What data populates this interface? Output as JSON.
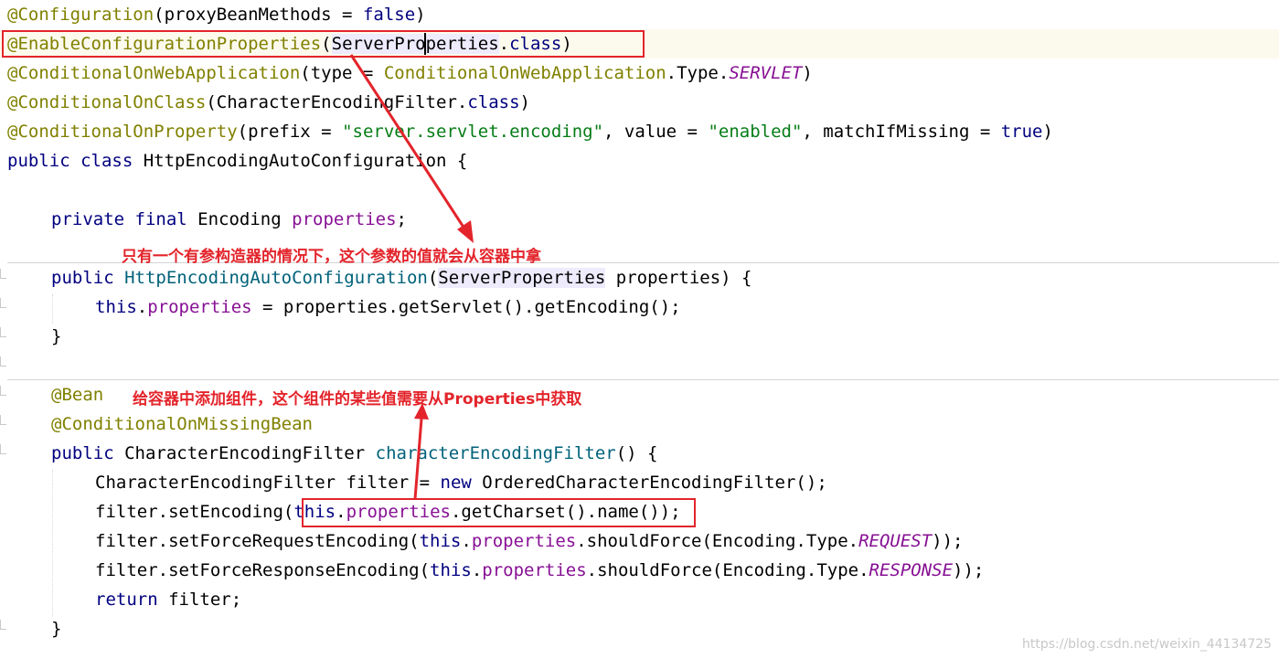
{
  "code": {
    "l1": {
      "a": "@Configuration",
      "b": "(proxyBeanMethods = ",
      "c": "false",
      "d": ")"
    },
    "l2": {
      "a": "@EnableConfigurationProperties",
      "b": "(",
      "c": "ServerProperties",
      "d": ".",
      "e": "class",
      "f": ")"
    },
    "l3": {
      "a": "@ConditionalOnWebApplication",
      "b": "(type = ",
      "c": "ConditionalOnWebApplication",
      "d": ".Type.",
      "e": "SERVLET",
      "f": ")"
    },
    "l4": {
      "a": "@ConditionalOnClass",
      "b": "(CharacterEncodingFilter.",
      "c": "class",
      "d": ")"
    },
    "l5": {
      "a": "@ConditionalOnProperty",
      "b": "(prefix = ",
      "c": "\"server.servlet.encoding\"",
      "d": ", value = ",
      "e": "\"enabled\"",
      "f": ", matchIfMissing = ",
      "g": "true",
      "h": ")"
    },
    "l6": {
      "a": "public",
      "b": " ",
      "c": "class",
      "d": " HttpEncodingAutoConfiguration {"
    },
    "l7": {
      "a": "private",
      "b": " ",
      "c": "final",
      "d": " Encoding ",
      "e": "properties",
      "f": ";"
    },
    "l8": {
      "a": "public",
      "b": " ",
      "c": "HttpEncodingAutoConfiguration",
      "d": "(",
      "e": "ServerProperties",
      "f": " properties) {"
    },
    "l9": {
      "a": "this",
      "b": ".",
      "c": "properties",
      "d": " = properties.getServlet().getEncoding();"
    },
    "l10": {
      "a": "}"
    },
    "l11": {
      "a": "@Bean"
    },
    "l12": {
      "a": "@ConditionalOnMissingBean"
    },
    "l13": {
      "a": "public",
      "b": " CharacterEncodingFilter ",
      "c": "characterEncodingFilter",
      "d": "() {"
    },
    "l14": {
      "a": "CharacterEncodingFilter filter = ",
      "b": "new",
      "c": " OrderedCharacterEncodingFilter();"
    },
    "l15": {
      "a": "filter.setEncoding(",
      "b": "this",
      "c": ".",
      "d": "properties",
      "e": ".getCharset().name());"
    },
    "l16": {
      "a": "filter.setForceRequestEncoding(",
      "b": "this",
      "c": ".",
      "d": "properties",
      "e": ".shouldForce(Encoding.Type.",
      "f": "REQUEST",
      "g": "));"
    },
    "l17": {
      "a": "filter.setForceResponseEncoding(",
      "b": "this",
      "c": ".",
      "d": "properties",
      "e": ".shouldForce(Encoding.Type.",
      "f": "RESPONSE",
      "g": "));"
    },
    "l18": {
      "a": "return",
      "b": " filter;"
    },
    "l19": {
      "a": "}"
    }
  },
  "annotations": {
    "note1": "只有一个有参构造器的情况下，这个参数的值就会从容器中拿",
    "note2": "给容器中添加组件，这个组件的某些值需要从Properties中获取"
  },
  "colors": {
    "annotation": "#808000",
    "keyword": "#000080",
    "field": "#871094",
    "string": "#067d17",
    "method": "#00627a",
    "markup_red": "#e3242b"
  },
  "watermark": "https://blog.csdn.net/weixin_44134725"
}
